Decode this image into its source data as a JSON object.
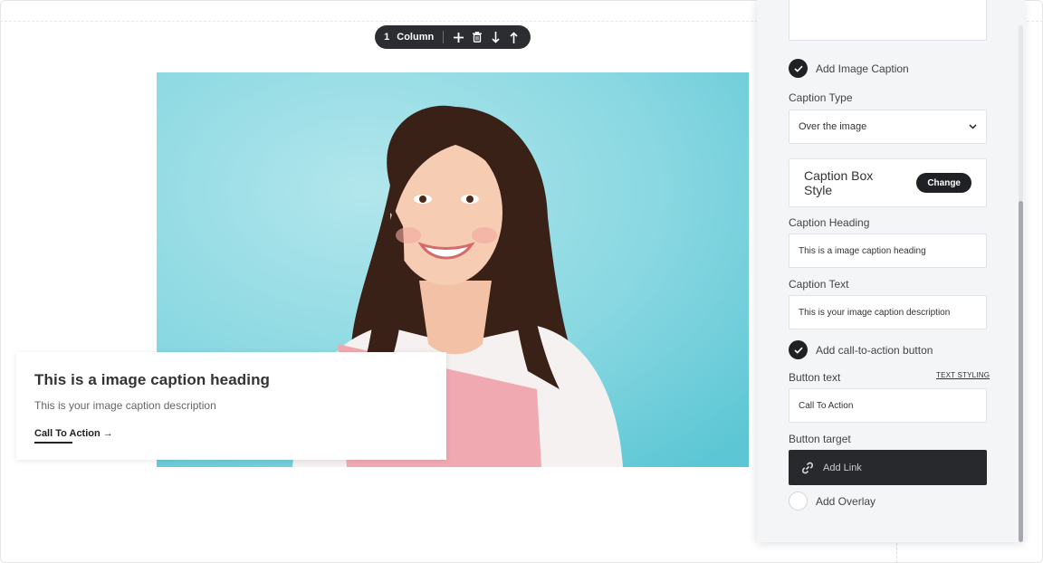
{
  "column_toolbar": {
    "count": "1",
    "label": "Column",
    "icons": [
      "plus-icon",
      "trash-icon",
      "arrow-down-icon",
      "arrow-up-icon"
    ]
  },
  "caption": {
    "heading": "This is a image caption heading",
    "text": "This is your image caption description",
    "cta": "Call To Action →"
  },
  "panel": {
    "add_image_caption": "Add Image Caption",
    "caption_type_label": "Caption Type",
    "caption_type_value": "Over the image",
    "caption_box_style_label": "Caption Box Style",
    "change_button": "Change",
    "caption_heading_label": "Caption Heading",
    "caption_heading_value": "This is a image caption heading",
    "caption_text_label": "Caption Text",
    "caption_text_value": "This is your image caption description",
    "add_cta_label": "Add call-to-action button",
    "button_text_label": "Button text",
    "text_styling_link": "TEXT STYLING",
    "button_text_value": "Call To Action",
    "button_target_label": "Button target",
    "add_link_label": "Add Link",
    "add_overlay_label": "Add Overlay"
  },
  "colors": {
    "toolbar_bg": "#2b2d31",
    "image_bg": "#8fdbe3",
    "panel_bg": "#f4f5f7",
    "dark_button": "#27292d"
  }
}
